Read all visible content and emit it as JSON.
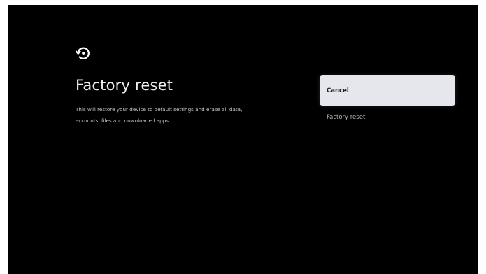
{
  "screen": {
    "icon": "factory-reset-icon",
    "title": "Factory reset",
    "description": "This will restore your device to default settings and erase all data, accounts, files and downloaded apps."
  },
  "options": [
    {
      "label": "Cancel",
      "focused": true
    },
    {
      "label": "Factory reset",
      "focused": false
    }
  ],
  "colors": {
    "background": "#000000",
    "focused_option": "#e6e7ec",
    "title_text": "#eeeeee"
  }
}
